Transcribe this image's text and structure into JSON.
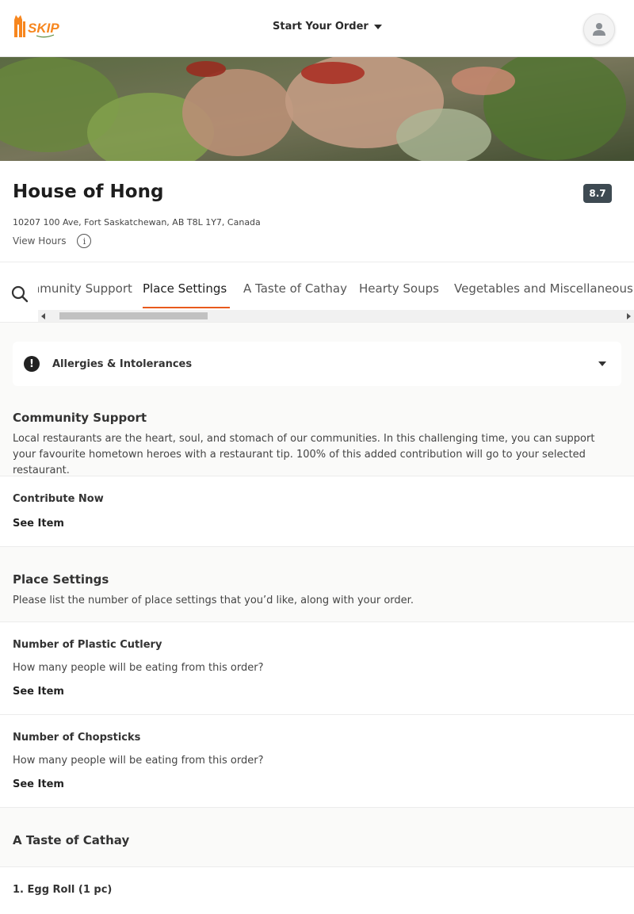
{
  "header": {
    "logo_text": "SKIP",
    "order_label": "Start Your Order"
  },
  "restaurant": {
    "name": "House of Hong",
    "rating": "8.7",
    "address": "10207 100 Ave, Fort Saskatchewan, AB T8L 1Y7, Canada",
    "hours_label": "View Hours"
  },
  "tabs": [
    {
      "label": "Community Support"
    },
    {
      "label": "Place Settings"
    },
    {
      "label": "A Taste of Cathay"
    },
    {
      "label": "Hearty Soups"
    },
    {
      "label": "Vegetables and Miscellaneous"
    }
  ],
  "allergy": {
    "label": "Allergies & Intolerances"
  },
  "sections": {
    "community": {
      "title": "Community Support",
      "description": "Local restaurants are the heart, soul, and stomach of our communities. In this challenging time, you can support your favourite hometown heroes with a restaurant tip. 100% of this added contribution will go to your selected restaurant.",
      "items": [
        {
          "name": "Contribute Now",
          "action": "See Item"
        }
      ]
    },
    "place_settings": {
      "title": "Place Settings",
      "description": "Please list the number of place settings that you’d like, along with your order.",
      "items": [
        {
          "name": "Number of Plastic Cutlery",
          "description": "How many people will be eating from this order?",
          "action": "See Item"
        },
        {
          "name": "Number of Chopsticks",
          "description": "How many people will be eating from this order?",
          "action": "See Item"
        }
      ]
    },
    "cathay": {
      "title": "A Taste of Cathay",
      "items": [
        {
          "name": "1. Egg Roll (1 pc)"
        }
      ]
    }
  },
  "colors": {
    "brand_orange": "#e85a1c",
    "rating_bg": "#3e4a52"
  },
  "icons": [
    "skip-logo",
    "caret-down-icon",
    "user-icon",
    "info-icon",
    "search-icon",
    "alert-icon"
  ]
}
